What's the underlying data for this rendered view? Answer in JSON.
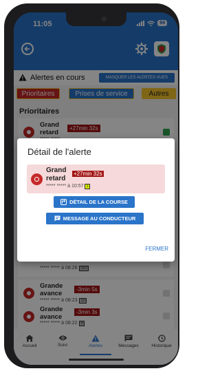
{
  "status_bar": {
    "time": "11:05",
    "battery": "94"
  },
  "header": {
    "alert_section_title": "Alertes en cours",
    "hide_alerts_label": "MASQUER LES ALERTES VUES"
  },
  "tabs": [
    {
      "label": "Prioritaires"
    },
    {
      "label": "Prises de service"
    },
    {
      "label": "Autres"
    }
  ],
  "section_title": "Prioritaires",
  "cards": [
    {
      "name": "Grand retard",
      "duration": "+27min 32s",
      "subtitle": "***** *****"
    },
    {
      "name": "",
      "duration": "",
      "subtitle": "***** ***** à 08:26",
      "number": "107"
    },
    {
      "name": "Grande avance",
      "duration": "-3min 5s",
      "subtitle": "***** ***** à 08:23",
      "number": "10"
    },
    {
      "name": "Grande avance",
      "duration": "-3min 3s",
      "subtitle": "***** ***** à 08:22",
      "number": "6"
    }
  ],
  "dialog": {
    "title": "Détail de l'alerte",
    "alert_name": "Grand retard",
    "alert_duration": "+27min 32s",
    "alert_subtitle": "***** ***** à 10:57",
    "alert_number": "1",
    "course_button": "DÉTAIL DE LA COURSE",
    "message_button": "MESSAGE AU CONDUCTEUR",
    "close_button": "FERMER"
  },
  "bottom_nav": [
    {
      "label": "Accueil",
      "icon": "home-icon"
    },
    {
      "label": "Suivi",
      "icon": "eye-icon"
    },
    {
      "label": "Alertes",
      "icon": "warning-icon"
    },
    {
      "label": "Messages",
      "icon": "message-icon"
    },
    {
      "label": "Historique",
      "icon": "history-icon"
    }
  ],
  "colors": {
    "primary": "#2a74c9",
    "danger": "#c62828",
    "warning": "#f3c22b"
  }
}
